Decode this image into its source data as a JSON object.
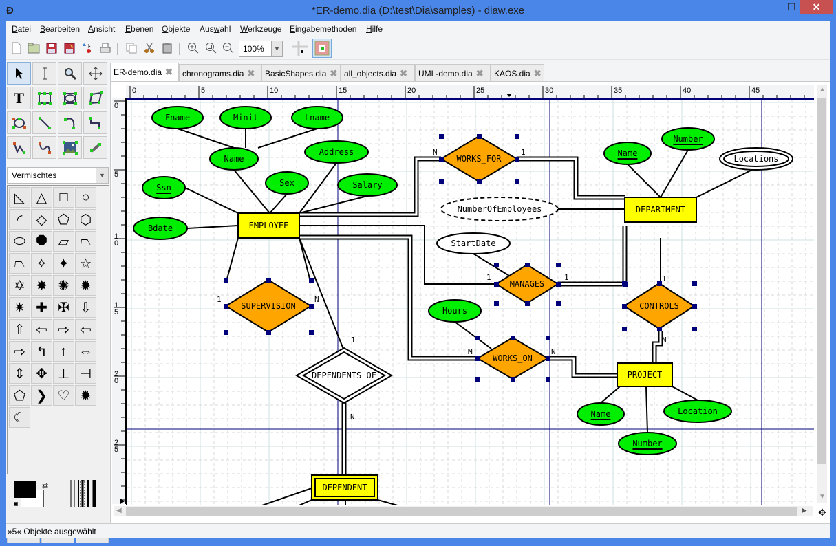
{
  "window": {
    "title": "*ER-demo.dia (D:\\test\\Dia\\samples) - diaw.exe",
    "controls": {
      "minimize": "—",
      "maximize": "☐",
      "close": "✕"
    }
  },
  "menubar": {
    "items": [
      {
        "label": "Datei",
        "mnemonic": "D"
      },
      {
        "label": "Bearbeiten",
        "mnemonic": "B"
      },
      {
        "label": "Ansicht",
        "mnemonic": "A"
      },
      {
        "label": "Ebenen",
        "mnemonic": "E"
      },
      {
        "label": "Objekte",
        "mnemonic": "O"
      },
      {
        "label": "Auswahl",
        "mnemonic": "w"
      },
      {
        "label": "Werkzeuge",
        "mnemonic": "W"
      },
      {
        "label": "Eingabemethoden",
        "mnemonic": "E"
      },
      {
        "label": "Hilfe",
        "mnemonic": "H"
      }
    ]
  },
  "toolbar": {
    "buttons": [
      "new-icon",
      "open-icon",
      "save-icon",
      "save-as-icon",
      "export-icon",
      "print-icon",
      "copy-icon",
      "cut-icon",
      "paste-icon",
      "zoom-in-icon",
      "zoom-fit-icon",
      "zoom-out-icon"
    ],
    "zoom_value": "100%",
    "snap_grid": "snap-to-grid-toggle",
    "snap_object": "snap-to-object-toggle"
  },
  "toolbox": {
    "tools": [
      "pointer",
      "text-edit",
      "magnify",
      "scroll",
      "text",
      "box",
      "ellipse",
      "polygon",
      "beziergon",
      "line",
      "arc",
      "zigzag-line",
      "polyline",
      "bezier-line",
      "image",
      "outline"
    ],
    "sheet_selected": "Vermischtes",
    "shapes": [
      "right-triangle",
      "triangle",
      "square",
      "circle",
      "quarter-circle",
      "diamond",
      "pentagon",
      "hexagon",
      "heptagon",
      "octagon",
      "parallelogram",
      "trapezoid-skew",
      "trapezoid",
      "four-point-star-1",
      "four-point-star-2",
      "five-point-star",
      "six-point-star",
      "seven-point-star",
      "eight-point-star",
      "sun-burst",
      "sun-burst-2",
      "cross",
      "maltese-cross",
      "arrow-down",
      "arrow-up",
      "arrow-left",
      "arrow-right",
      "arrow-left-notched",
      "arrow-right-notched",
      "arrow-turn-up-left",
      "arrow-turn-up",
      "arrow-left-right",
      "arrow-up-down",
      "arrow-four-way",
      "arrow-three-way",
      "arrow-up-down-left",
      "pentagon-tag",
      "chevron",
      "heart",
      "sun",
      "moon"
    ],
    "fg_color": "#000000",
    "bg_color": "#ffffff"
  },
  "tabs": [
    {
      "label": "ER-demo.dia",
      "active": true
    },
    {
      "label": "chronograms.dia",
      "active": false
    },
    {
      "label": "BasicShapes.dia",
      "active": false
    },
    {
      "label": "all_objects.dia",
      "active": false
    },
    {
      "label": "UML-demo.dia",
      "active": false
    },
    {
      "label": "KAOS.dia",
      "active": false
    }
  ],
  "rulers": {
    "horizontal": [
      "0",
      "5",
      "10",
      "15",
      "20",
      "25",
      "30",
      "35",
      "40",
      "45"
    ],
    "vertical": [
      "0",
      "5",
      "10",
      "15",
      "20",
      "25"
    ]
  },
  "diagram": {
    "colors": {
      "entity": "#ffff00",
      "relationship": "#ffa500",
      "attribute": "#00ee00",
      "handle": "#00007a",
      "guide": "#00007a"
    },
    "entities": [
      {
        "id": "employee",
        "label": "EMPLOYEE",
        "weak": false
      },
      {
        "id": "department",
        "label": "DEPARTMENT",
        "weak": false
      },
      {
        "id": "project",
        "label": "PROJECT",
        "weak": false
      },
      {
        "id": "dependent",
        "label": "DEPENDENT",
        "weak": true
      }
    ],
    "relationships": [
      {
        "id": "works_for",
        "label": "WORKS_FOR",
        "left_card": "N",
        "right_card": "1"
      },
      {
        "id": "manages",
        "label": "MANAGES",
        "left_card": "1",
        "right_card": "1"
      },
      {
        "id": "works_on",
        "label": "WORKS_ON",
        "left_card": "M",
        "right_card": "N"
      },
      {
        "id": "controls",
        "label": "CONTROLS",
        "top_card": "1",
        "bottom_card": "N"
      },
      {
        "id": "supervision",
        "label": "SUPERVISION",
        "left_card": "1",
        "right_card": "N"
      },
      {
        "id": "dependents_of",
        "label": "DEPENDENTS_OF",
        "top_card": "1",
        "bottom_card": "N",
        "identifying": true
      }
    ],
    "attributes": [
      {
        "id": "fname",
        "label": "Fname"
      },
      {
        "id": "minit",
        "label": "Minit"
      },
      {
        "id": "lname",
        "label": "Lname"
      },
      {
        "id": "name",
        "label": "Name"
      },
      {
        "id": "address",
        "label": "Address"
      },
      {
        "id": "ssn",
        "label": "Ssn",
        "key": true
      },
      {
        "id": "sex",
        "label": "Sex"
      },
      {
        "id": "salary",
        "label": "Salary"
      },
      {
        "id": "bdate",
        "label": "Bdate"
      },
      {
        "id": "dname",
        "label": "Name",
        "key": true
      },
      {
        "id": "dnumber",
        "label": "Number",
        "key": true
      },
      {
        "id": "locations",
        "label": "Locations",
        "multivalued": true
      },
      {
        "id": "numemp",
        "label": "NumberOfEmployees",
        "derived": true
      },
      {
        "id": "startdate",
        "label": "StartDate"
      },
      {
        "id": "hours",
        "label": "Hours"
      },
      {
        "id": "pname",
        "label": "Name",
        "key": true
      },
      {
        "id": "plocation",
        "label": "Location"
      },
      {
        "id": "pnumber",
        "label": "Number",
        "key": true
      }
    ]
  },
  "status": {
    "text": "»5« Objekte ausgewählt"
  }
}
